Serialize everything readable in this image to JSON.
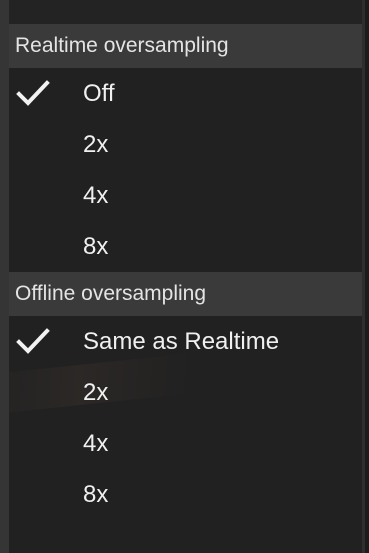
{
  "menu": {
    "sections": [
      {
        "header": "Realtime oversampling",
        "items": [
          {
            "label": "Off",
            "checked": true
          },
          {
            "label": "2x",
            "checked": false
          },
          {
            "label": "4x",
            "checked": false
          },
          {
            "label": "8x",
            "checked": false
          }
        ]
      },
      {
        "header": "Offline oversampling",
        "items": [
          {
            "label": "Same as Realtime",
            "checked": true
          },
          {
            "label": "2x",
            "checked": false
          },
          {
            "label": "4x",
            "checked": false
          },
          {
            "label": "8x",
            "checked": false
          }
        ]
      }
    ],
    "check_icon": "checkmark-icon",
    "colors": {
      "background": "#212121",
      "header_background": "#3a3a3a",
      "text": "#f0f0f0"
    }
  }
}
